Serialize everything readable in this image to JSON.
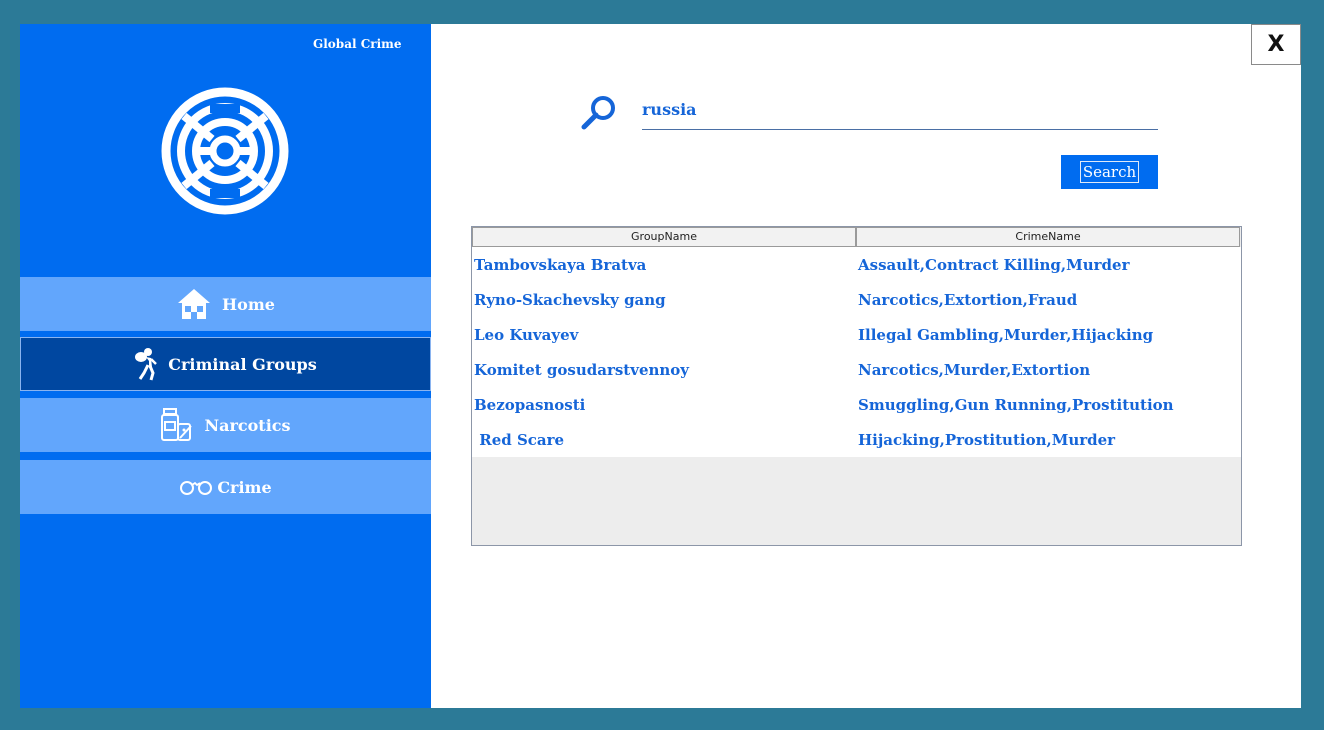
{
  "app": {
    "title": "Global Crime"
  },
  "nav": {
    "items": [
      {
        "label": "Home",
        "icon": "home-icon"
      },
      {
        "label": "Criminal Groups",
        "icon": "thief-icon"
      },
      {
        "label": "Narcotics",
        "icon": "narcotics-icon"
      },
      {
        "label": "Crime",
        "icon": "handcuffs-icon"
      }
    ],
    "active": "Criminal Groups"
  },
  "close": {
    "label": "X"
  },
  "search": {
    "value": "russia",
    "button_label": "Search"
  },
  "table": {
    "columns": [
      "GroupName",
      "CrimeName"
    ],
    "rows": [
      [
        "Tambovskaya Bratva",
        "Assault,Contract Killing,Murder"
      ],
      [
        "Ryno-Skachevsky gang",
        "Narcotics,Extortion,Fraud"
      ],
      [
        "Leo Kuvayev",
        "Illegal Gambling,Murder,Hijacking"
      ],
      [
        "Komitet gosudarstvennoy",
        "Narcotics,Murder,Extortion"
      ],
      [
        "Bezopasnosti",
        "Smuggling,Gun Running,Prostitution"
      ],
      [
        " Red Scare",
        "Hijacking,Prostitution,Murder"
      ]
    ]
  },
  "colors": {
    "sidebar": "#006cf0",
    "nav_item": "#62a6fc",
    "nav_active": "#0047a0",
    "background": "#2c7a97",
    "text_accent": "#1565d8"
  }
}
